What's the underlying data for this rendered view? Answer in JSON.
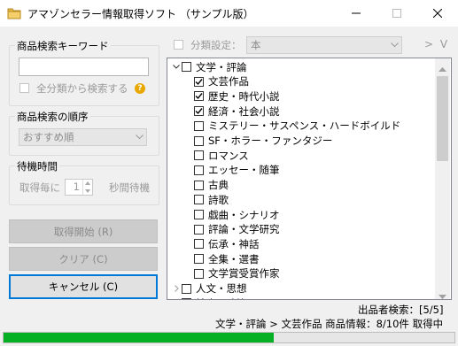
{
  "window": {
    "title": "アマゾンセラー情報取得ソフト （サンプル版）",
    "minimize": "—",
    "maximize": "☐",
    "close": "✕"
  },
  "keyword_group": {
    "label": "商品検索キーワード",
    "input_value": "",
    "all_categories_label": "全分類から検索する",
    "all_categories_checked": false,
    "help_icon": "?"
  },
  "order_group": {
    "label": "商品検索の順序",
    "selected": "おすすめ順"
  },
  "wait_group": {
    "label": "待機時間",
    "prefix": "取得毎に",
    "value": "1",
    "suffix": "秒間待機"
  },
  "buttons": {
    "start": "取得開始 (R)",
    "clear": "クリア (C)",
    "cancel": "キャンセル (C)"
  },
  "category_setting": {
    "label": "分類設定：",
    "checked": false,
    "selected": "本",
    "nav": "> V"
  },
  "tree": [
    {
      "label": "文学・評論",
      "level": 0,
      "expander": "v",
      "checked": false
    },
    {
      "label": "文芸作品",
      "level": 1,
      "expander": "",
      "checked": true
    },
    {
      "label": "歴史・時代小説",
      "level": 1,
      "expander": "",
      "checked": true
    },
    {
      "label": "経済・社会小説",
      "level": 1,
      "expander": "",
      "checked": true
    },
    {
      "label": "ミステリー・サスペンス・ハードボイルド",
      "level": 1,
      "expander": "",
      "checked": false
    },
    {
      "label": "SF・ホラー・ファンタジー",
      "level": 1,
      "expander": "",
      "checked": false
    },
    {
      "label": "ロマンス",
      "level": 1,
      "expander": "",
      "checked": false
    },
    {
      "label": "エッセー・随筆",
      "level": 1,
      "expander": "",
      "checked": false
    },
    {
      "label": "古典",
      "level": 1,
      "expander": "",
      "checked": false
    },
    {
      "label": "詩歌",
      "level": 1,
      "expander": "",
      "checked": false
    },
    {
      "label": "戯曲・シナリオ",
      "level": 1,
      "expander": "",
      "checked": false
    },
    {
      "label": "評論・文学研究",
      "level": 1,
      "expander": "",
      "checked": false
    },
    {
      "label": "伝承・神話",
      "level": 1,
      "expander": "",
      "checked": false
    },
    {
      "label": "全集・選書",
      "level": 1,
      "expander": "",
      "checked": false
    },
    {
      "label": "文学賞受賞作家",
      "level": 1,
      "expander": "",
      "checked": false
    },
    {
      "label": "人文・思想",
      "level": 0,
      "expander": ">",
      "checked": false
    },
    {
      "label": "社会・政治",
      "level": 0,
      "expander": ">",
      "checked": false
    }
  ],
  "status": {
    "seller_search": "出品者検索：[5/5]",
    "progress_text": "文学・評論 > 文芸作品 商品情報：8/10件 取得中",
    "progress_fraction": 0.6
  },
  "icons": {
    "app": "folder-icon",
    "help": "help-icon",
    "dropdown": "chevron-down-icon",
    "check": "checkmark-icon"
  },
  "colors": {
    "accent": "#0078d7",
    "progress": "#06b025",
    "help": "#e8a800"
  }
}
